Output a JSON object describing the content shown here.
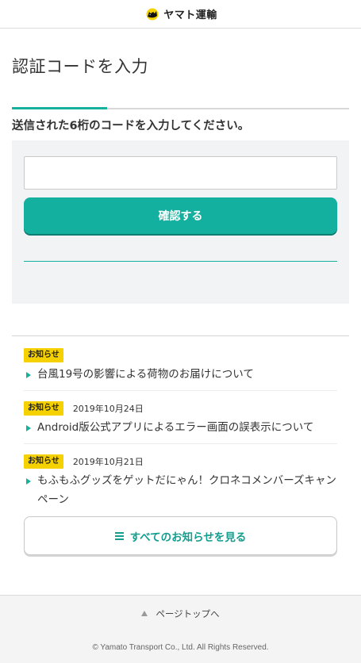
{
  "header": {
    "logo_text": "ヤマト運輸",
    "logo_icon": "kuroneko-cat-icon"
  },
  "page": {
    "title": "認証コードを入力",
    "instruction": "送信された6桁のコードを入力してください。"
  },
  "form": {
    "code_value": "",
    "code_placeholder": "",
    "confirm_label": "確認する"
  },
  "news": {
    "badge": "お知らせ",
    "items": [
      {
        "badge": "お知らせ",
        "date": "",
        "title": "台風19号の影響による荷物のお届けについて"
      },
      {
        "badge": "お知らせ",
        "date": "2019年10月24日",
        "title": "Android版公式アプリによるエラー画面の誤表示について"
      },
      {
        "badge": "お知らせ",
        "date": "2019年10月21日",
        "title": "もふもふグッズをゲットだにゃん！クロネコメンバーズキャンペーン"
      }
    ],
    "all_label": "すべてのお知らせを見る",
    "all_icon": "list-icon"
  },
  "pagetop": {
    "label": "ページトップへ",
    "icon": "triangle-up-icon"
  },
  "footer": {
    "copyright": "© Yamato Transport Co., Ltd. All Rights Reserved."
  },
  "colors": {
    "accent": "#14b09f",
    "badge": "#f6d100",
    "panel_bg": "#f2f3f5"
  }
}
